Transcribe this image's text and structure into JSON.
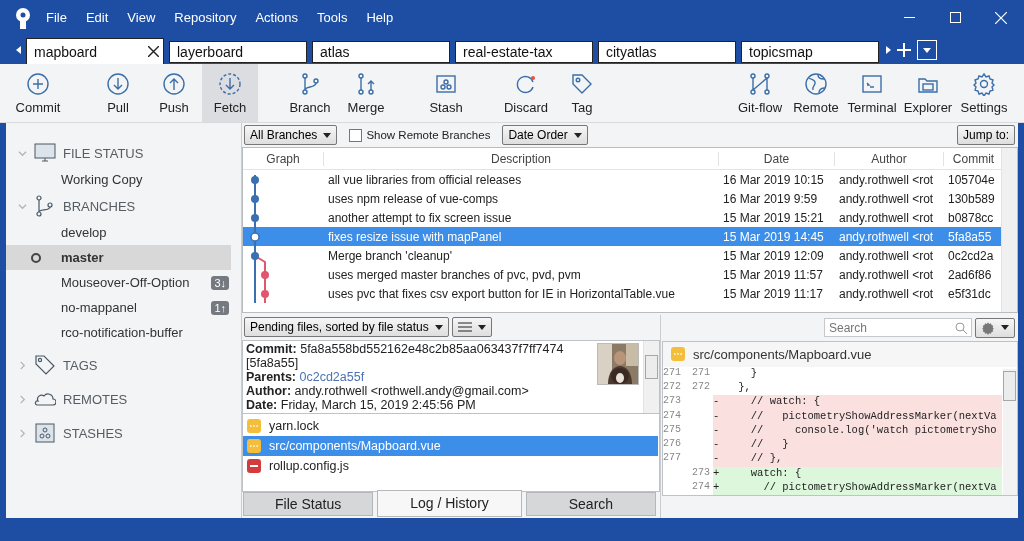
{
  "menu": [
    "File",
    "Edit",
    "View",
    "Repository",
    "Actions",
    "Tools",
    "Help"
  ],
  "repo_tabs": [
    {
      "label": "mapboard",
      "selected": true
    },
    {
      "label": "layerboard",
      "selected": false
    },
    {
      "label": "atlas",
      "selected": false
    },
    {
      "label": "real-estate-tax",
      "selected": false
    },
    {
      "label": "cityatlas",
      "selected": false
    },
    {
      "label": "topicsmap",
      "selected": false
    }
  ],
  "toolbar_groups": [
    [
      {
        "label": "Commit",
        "selected": false
      }
    ],
    [
      {
        "label": "Pull",
        "selected": false
      },
      {
        "label": "Push",
        "selected": false
      },
      {
        "label": "Fetch",
        "selected": true
      }
    ],
    [
      {
        "label": "Branch",
        "selected": false
      },
      {
        "label": "Merge",
        "selected": false
      }
    ],
    [
      {
        "label": "Stash",
        "selected": false
      }
    ],
    [
      {
        "label": "Discard",
        "selected": false
      },
      {
        "label": "Tag",
        "selected": false
      }
    ]
  ],
  "toolbar_right": [
    {
      "label": "Git-flow",
      "selected": false
    },
    {
      "label": "Remote",
      "selected": false
    },
    {
      "label": "Terminal",
      "selected": false
    },
    {
      "label": "Explorer",
      "selected": false
    },
    {
      "label": "Settings",
      "selected": false
    }
  ],
  "sidebar": [
    {
      "title": "FILE STATUS",
      "expanded": true,
      "items": [
        {
          "label": "Working Copy",
          "selected": false,
          "current": false
        }
      ]
    },
    {
      "title": "BRANCHES",
      "expanded": true,
      "items": [
        {
          "label": "develop",
          "selected": false,
          "current": false
        },
        {
          "label": "master",
          "selected": true,
          "current": true
        },
        {
          "label": "Mouseover-Off-Option",
          "selected": false,
          "current": false,
          "badge": "3↓"
        },
        {
          "label": "no-mappanel",
          "selected": false,
          "current": false,
          "badge": "1↑"
        },
        {
          "label": "rco-notification-buffer",
          "selected": false,
          "current": false
        }
      ]
    },
    {
      "title": "TAGS",
      "expanded": false
    },
    {
      "title": "REMOTES",
      "expanded": false
    },
    {
      "title": "STASHES",
      "expanded": false
    }
  ],
  "filter": {
    "branches": "All Branches",
    "show_remote": {
      "label": "Show Remote Branches",
      "checked": false
    },
    "order": "Date Order",
    "jump": "Jump to:"
  },
  "commits": {
    "columns": [
      "Graph",
      "Description",
      "Date",
      "Author",
      "Commit"
    ],
    "rows": [
      {
        "description": "all vue libraries from official releases",
        "date": "16 Mar 2019 10:15",
        "author": "andy.rothwell <rot",
        "commit": "105704e",
        "selected": false,
        "head": false,
        "color": "#3a6fb0"
      },
      {
        "description": "uses npm release of vue-comps",
        "date": "16 Mar 2019 9:59",
        "author": "andy.rothwell <rot",
        "commit": "130b589",
        "selected": false,
        "head": false,
        "color": "#3a6fb0"
      },
      {
        "description": "another attempt to fix screen issue",
        "date": "15 Mar 2019 15:21",
        "author": "andy.rothwell <rot",
        "commit": "b0878cc",
        "selected": false,
        "head": false,
        "color": "#3a6fb0"
      },
      {
        "description": "fixes resize issue with mapPanel",
        "date": "15 Mar 2019 14:45",
        "author": "andy.rothwell <rot",
        "commit": "5fa8a55",
        "selected": true,
        "head": true,
        "color": "#3a6fb0"
      },
      {
        "description": "Merge branch 'cleanup'",
        "date": "15 Mar 2019 12:09",
        "author": "andy.rothwell <rot",
        "commit": "0c2cd2a",
        "selected": false,
        "head": false,
        "color": "#3a6fb0"
      },
      {
        "description": "uses merged master branches of pvc, pvd, pvm",
        "date": "15 Mar 2019 11:57",
        "author": "andy.rothwell <rot",
        "commit": "2ad6f86",
        "selected": false,
        "head": false,
        "color": "#e0566f"
      },
      {
        "description": "uses pvc that fixes csv export button for IE in HorizontalTable.vue",
        "date": "15 Mar 2019 11:17",
        "author": "andy.rothwell <rot",
        "commit": "e5f31dc",
        "selected": false,
        "head": false,
        "color": "#e0566f"
      }
    ]
  },
  "details_toolbar": {
    "view": "Pending files, sorted by file status"
  },
  "details": [
    {
      "label": "Commit:",
      "value": "5fa8a558bd552162e48c2b85aa063437f7ff7474 [5fa8a55]",
      "kind": "text"
    },
    {
      "label": "Parents:",
      "value": "0c2cd2a55f",
      "kind": "link"
    },
    {
      "label": "Author:",
      "value": "andy.rothwell <rothwell.andy@gmail.com>",
      "kind": "text"
    },
    {
      "label": "Date:",
      "value": "Friday, March 15, 2019 2:45:56 PM",
      "kind": "text"
    }
  ],
  "files": [
    {
      "name": "yarn.lock",
      "kind": "modified",
      "selected": false
    },
    {
      "name": "src/components/Mapboard.vue",
      "kind": "modified",
      "selected": true
    },
    {
      "name": "rollup.config.js",
      "kind": "removed",
      "selected": false
    }
  ],
  "bottom_tabs": [
    {
      "label": "File Status",
      "selected": false
    },
    {
      "label": "Log / History",
      "selected": true
    },
    {
      "label": "Search",
      "selected": false
    }
  ],
  "diff": {
    "search": {
      "placeholder": "Search"
    },
    "file": "src/components/Mapboard.vue",
    "lines": [
      {
        "old": "271",
        "new": "271",
        "kind": "context",
        "text": "      }"
      },
      {
        "old": "272",
        "new": "272",
        "kind": "context",
        "text": "    },"
      },
      {
        "old": "273",
        "kind": "removed",
        "text": "-     // watch: {"
      },
      {
        "old": "274",
        "kind": "removed",
        "text": "-     //   pictometryShowAddressMarker(nextVa"
      },
      {
        "old": "275",
        "kind": "removed",
        "text": "-     //     console.log('watch pictometrySho"
      },
      {
        "old": "276",
        "kind": "removed",
        "text": "-     //   }"
      },
      {
        "old": "277",
        "kind": "removed",
        "text": "-     // },"
      },
      {
        "new": "273",
        "kind": "added",
        "text": "+     watch: {"
      },
      {
        "new": "274",
        "kind": "added",
        "text": "+       // pictometryShowAddressMarker(nextVa"
      }
    ]
  }
}
